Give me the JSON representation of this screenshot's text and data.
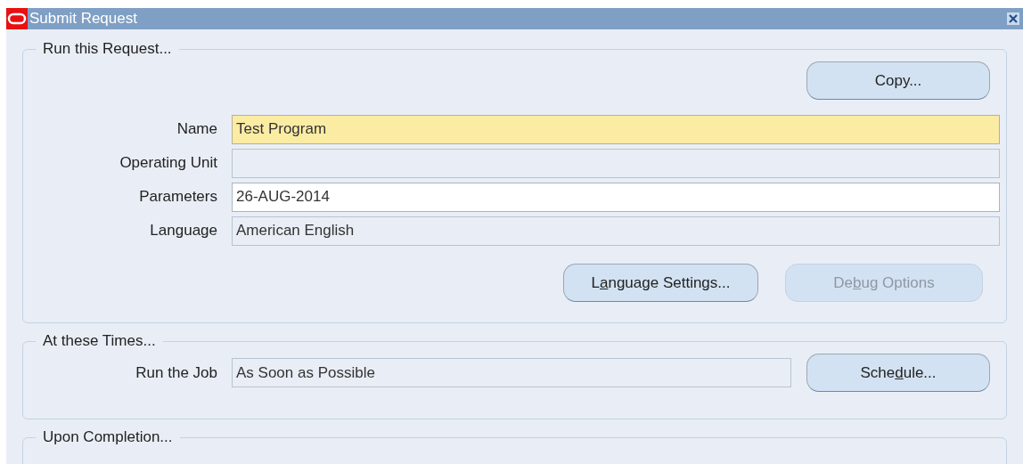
{
  "window": {
    "title": "Submit Request"
  },
  "run_request": {
    "title": "Run this Request...",
    "copy_button": {
      "label": "Copy...",
      "disabled": false
    },
    "fields": [
      {
        "label": "Name",
        "value": "Test Program",
        "kind": "required"
      },
      {
        "label": "Operating Unit",
        "kind": "readonly"
      },
      {
        "label": "Parameters",
        "value": "26-AUG-2014",
        "kind": "editable"
      },
      {
        "label": "Language",
        "value": "American English",
        "kind": "readonly"
      }
    ],
    "buttons": [
      {
        "label_start": "L",
        "mnemonic": "a",
        "label_end": "nguage Settings...",
        "disabled": false
      },
      {
        "label_start": "De",
        "mnemonic": "b",
        "label_end": "ug Options",
        "disabled": true
      }
    ]
  },
  "schedule": {
    "title": "At these Times...",
    "field": {
      "label": "Run the Job",
      "value": "As Soon as Possible",
      "kind": "readonly"
    },
    "button": {
      "label_start": "Sche",
      "mnemonic": "d",
      "label_end": "ule...",
      "disabled": false
    }
  },
  "completion": {
    "title": "Upon Completion..."
  }
}
